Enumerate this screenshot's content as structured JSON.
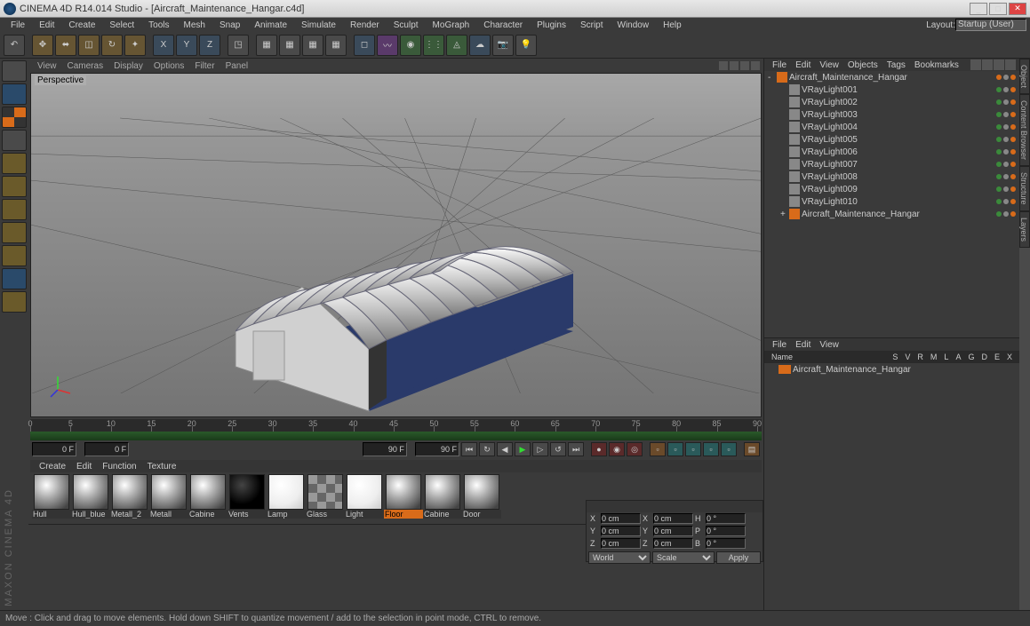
{
  "titlebar": {
    "title": "CINEMA 4D R14.014 Studio - [Aircraft_Maintenance_Hangar.c4d]"
  },
  "menubar": {
    "items": [
      "File",
      "Edit",
      "Create",
      "Select",
      "Tools",
      "Mesh",
      "Snap",
      "Animate",
      "Simulate",
      "Render",
      "Sculpt",
      "MoGraph",
      "Character",
      "Plugins",
      "Script",
      "Window",
      "Help"
    ],
    "layout_label": "Layout:",
    "layout_value": "Startup (User)"
  },
  "viewmenu": {
    "items": [
      "View",
      "Cameras",
      "Display",
      "Options",
      "Filter",
      "Panel"
    ]
  },
  "viewport": {
    "label": "Perspective"
  },
  "timeline": {
    "ticks": [
      "0",
      "5",
      "10",
      "15",
      "20",
      "25",
      "30",
      "35",
      "40",
      "45",
      "50",
      "55",
      "60",
      "65",
      "70",
      "75",
      "80",
      "85",
      "90"
    ],
    "cur_start": "0 F",
    "cur_end": "90 F",
    "range_start": "0 F",
    "range_end": "90 F"
  },
  "mat_menu": {
    "items": [
      "Create",
      "Edit",
      "Function",
      "Texture"
    ]
  },
  "materials": [
    {
      "name": "Hull",
      "style": ""
    },
    {
      "name": "Hull_blue",
      "style": ""
    },
    {
      "name": "Metall_2",
      "style": ""
    },
    {
      "name": "Metall",
      "style": ""
    },
    {
      "name": "Cabine",
      "style": ""
    },
    {
      "name": "Vents",
      "style": "black"
    },
    {
      "name": "Lamp",
      "style": "light"
    },
    {
      "name": "Glass",
      "style": "checker"
    },
    {
      "name": "Light",
      "style": "light"
    },
    {
      "name": "Floor",
      "style": "",
      "sel": true
    },
    {
      "name": "Cabine",
      "style": ""
    },
    {
      "name": "Door",
      "style": ""
    }
  ],
  "obj_menu": {
    "items": [
      "File",
      "Edit",
      "View",
      "Objects",
      "Tags",
      "Bookmarks"
    ]
  },
  "objects": [
    {
      "name": "Aircraft_Maintenance_Hangar",
      "depth": 0,
      "exp": "-",
      "root": true
    },
    {
      "name": "VRayLight001",
      "depth": 1,
      "light": true
    },
    {
      "name": "VRayLight002",
      "depth": 1,
      "light": true
    },
    {
      "name": "VRayLight003",
      "depth": 1,
      "light": true
    },
    {
      "name": "VRayLight004",
      "depth": 1,
      "light": true
    },
    {
      "name": "VRayLight005",
      "depth": 1,
      "light": true
    },
    {
      "name": "VRayLight006",
      "depth": 1,
      "light": true
    },
    {
      "name": "VRayLight007",
      "depth": 1,
      "light": true
    },
    {
      "name": "VRayLight008",
      "depth": 1,
      "light": true
    },
    {
      "name": "VRayLight009",
      "depth": 1,
      "light": true
    },
    {
      "name": "VRayLight010",
      "depth": 1,
      "light": true
    },
    {
      "name": "Aircraft_Maintenance_Hangar",
      "depth": 1,
      "exp": "+"
    }
  ],
  "attr_menu": {
    "items": [
      "File",
      "Edit",
      "View"
    ]
  },
  "attr_header": {
    "cols": [
      "Name",
      "S",
      "V",
      "R",
      "M",
      "L",
      "A",
      "G",
      "D",
      "E",
      "X"
    ]
  },
  "attr_row": {
    "name": "Aircraft_Maintenance_Hangar"
  },
  "coord": {
    "rows": [
      {
        "l1": "X",
        "v1": "0 cm",
        "l2": "X",
        "v2": "0 cm",
        "l3": "H",
        "v3": "0 °"
      },
      {
        "l1": "Y",
        "v1": "0 cm",
        "l2": "Y",
        "v2": "0 cm",
        "l3": "P",
        "v3": "0 °"
      },
      {
        "l1": "Z",
        "v1": "0 cm",
        "l2": "Z",
        "v2": "0 cm",
        "l3": "B",
        "v3": "0 °"
      }
    ],
    "sel1": "World",
    "sel2": "Scale",
    "btn": "Apply"
  },
  "status": {
    "text": "Move : Click and drag to move elements. Hold down SHIFT to quantize movement / add to the selection in point mode, CTRL to remove."
  },
  "right_tabs": [
    "Object",
    "Content Browser",
    "Structure",
    "Layers"
  ],
  "logo": "MAXON  CINEMA 4D"
}
